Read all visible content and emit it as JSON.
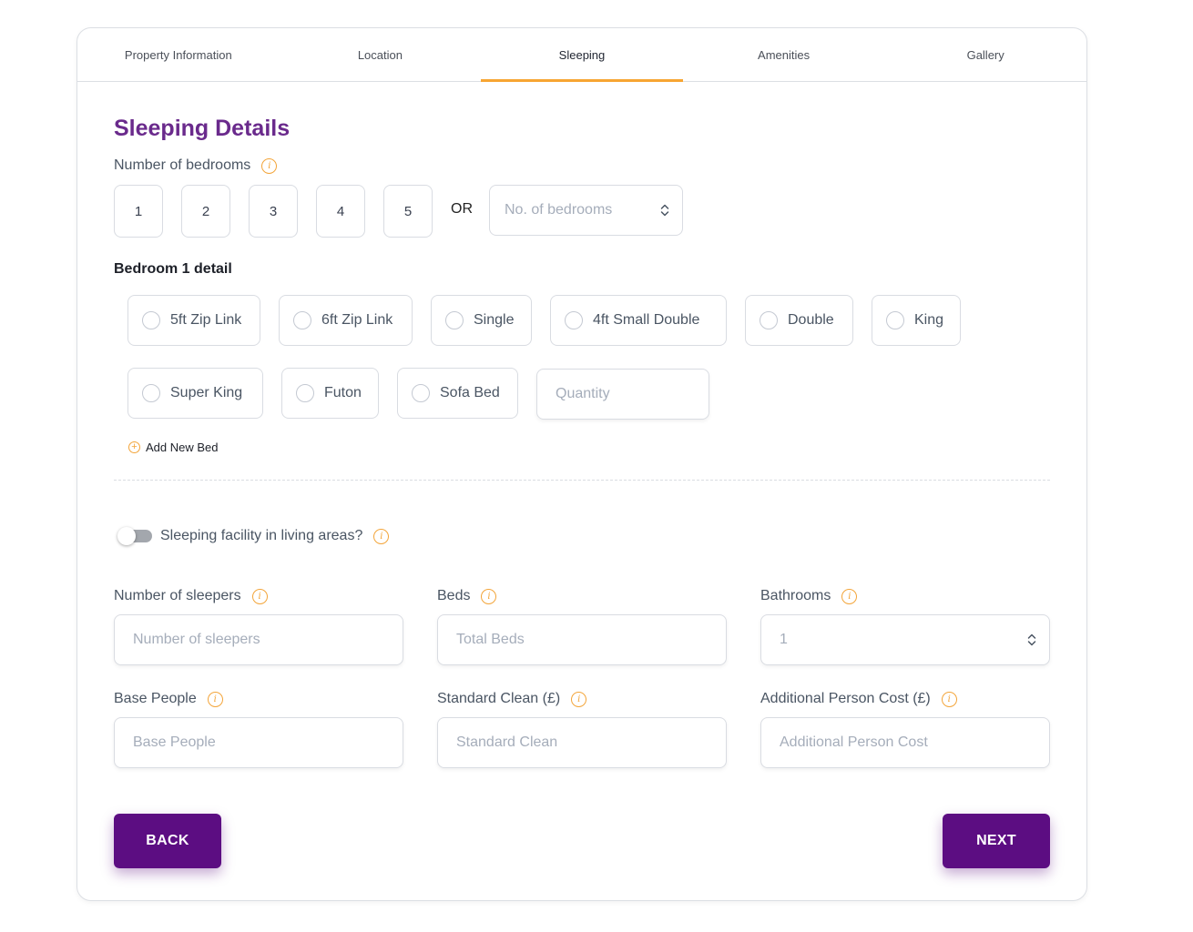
{
  "tabs": [
    {
      "label": "Property Information",
      "active": false
    },
    {
      "label": "Location",
      "active": false
    },
    {
      "label": "Sleeping",
      "active": true
    },
    {
      "label": "Amenities",
      "active": false
    },
    {
      "label": "Gallery",
      "active": false
    }
  ],
  "section_title": "Sleeping Details",
  "bedrooms": {
    "label": "Number of bedrooms",
    "options": [
      "1",
      "2",
      "3",
      "4",
      "5"
    ],
    "or_text": "OR",
    "select_placeholder": "No. of bedrooms"
  },
  "bedroom_detail": {
    "heading": "Bedroom 1 detail",
    "bed_types": [
      "5ft Zip Link",
      "6ft Zip Link",
      "Single",
      "4ft Small Double",
      "Double",
      "King",
      "Super King",
      "Futon",
      "Sofa Bed"
    ],
    "quantity_placeholder": "Quantity",
    "add_bed_label": "Add New Bed"
  },
  "living_areas": {
    "label": "Sleeping facility in living areas?",
    "enabled": false
  },
  "fields": {
    "sleepers": {
      "label": "Number of sleepers",
      "placeholder": "Number of sleepers"
    },
    "beds": {
      "label": "Beds",
      "placeholder": "Total Beds"
    },
    "bathrooms": {
      "label": "Bathrooms",
      "value": "1"
    },
    "base_people": {
      "label": "Base People",
      "placeholder": "Base People"
    },
    "standard_clean": {
      "label": "Standard Clean (£)",
      "placeholder": "Standard Clean"
    },
    "additional_cost": {
      "label": "Additional Person Cost (£)",
      "placeholder": "Additional Person Cost"
    }
  },
  "buttons": {
    "back": "BACK",
    "next": "NEXT"
  },
  "colors": {
    "primary": "#5c0d82",
    "title": "#6a2a8c",
    "accent": "#f7a532"
  },
  "info_icon_glyph": "i",
  "plus_icon_glyph": "+"
}
